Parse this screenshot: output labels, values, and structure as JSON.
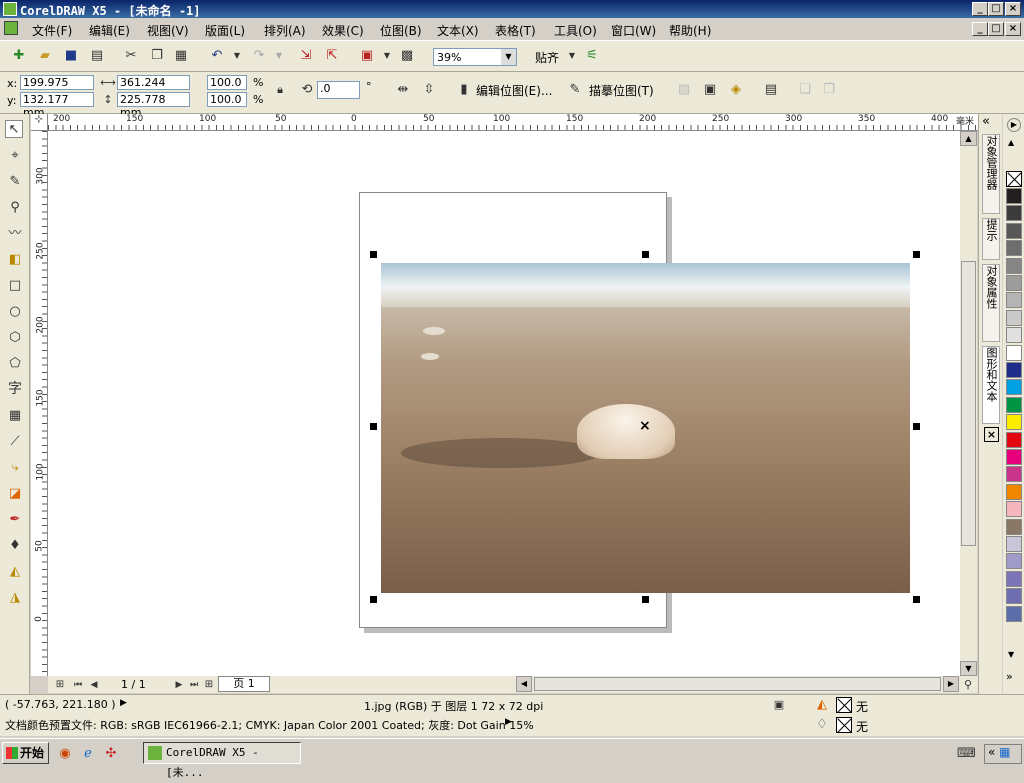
{
  "window": {
    "title": "CorelDRAW X5 - [未命名 -1]"
  },
  "menu": [
    "文件(F)",
    "编辑(E)",
    "视图(V)",
    "版面(L)",
    "排列(A)",
    "效果(C)",
    "位图(B)",
    "文本(X)",
    "表格(T)",
    "工具(O)",
    "窗口(W)",
    "帮助(H)"
  ],
  "toolbar": {
    "zoom": "39%",
    "snap_label": "贴齐"
  },
  "propbar": {
    "x_label": "x:",
    "x": "199.975 mm",
    "y_label": "y:",
    "y": "132.177 mm",
    "w": "361.244 mm",
    "h": "225.778 mm",
    "sx": "100.0",
    "sy": "100.0",
    "pct": "%",
    "rotation": ".0",
    "deg": "°",
    "edit_bitmap": "编辑位图(E)...",
    "trace_bitmap": "描摹位图(T)"
  },
  "ruler": {
    "unit": "毫米",
    "h_ticks": [
      "200",
      "150",
      "100",
      "50",
      "0",
      "50",
      "100",
      "150",
      "200",
      "250",
      "300",
      "350",
      "400"
    ],
    "v_ticks": [
      "300",
      "250",
      "200",
      "150",
      "100",
      "50",
      "0"
    ]
  },
  "dockers": [
    "对象管理器",
    "提示",
    "对象属性",
    "图形和文本"
  ],
  "palette": {
    "colors": [
      "#231f20",
      "#3b3b3b",
      "#575757",
      "#6d6d6d",
      "#858585",
      "#9c9c9c",
      "#b4b4b4",
      "#cacaca",
      "#e0e0e0",
      "#ffffff",
      "#1e2c8a",
      "#00a0e3",
      "#009444",
      "#ffed00",
      "#e30613",
      "#e6007e",
      "#c8358a",
      "#f18700",
      "#f7b6bd",
      "#8a7867",
      "#c9c6d9",
      "#9f9ac7",
      "#7d75b8",
      "#6d6db0",
      "#5c6daa"
    ]
  },
  "page_nav": {
    "count": "1 / 1",
    "tab": "页 1"
  },
  "status": {
    "coords": "( -57.763, 221.180 )",
    "object_info": "1.jpg (RGB) 于 图层 1 72 x 72 dpi",
    "fill_none": "无",
    "outline_none": "无",
    "profile": "文档颜色预置文件: RGB: sRGB IEC61966-2.1; CMYK: Japan Color 2001 Coated; 灰度: Dot Gain 15%"
  },
  "taskbar": {
    "start": "开始",
    "task": "CorelDRAW X5 - [未..."
  }
}
